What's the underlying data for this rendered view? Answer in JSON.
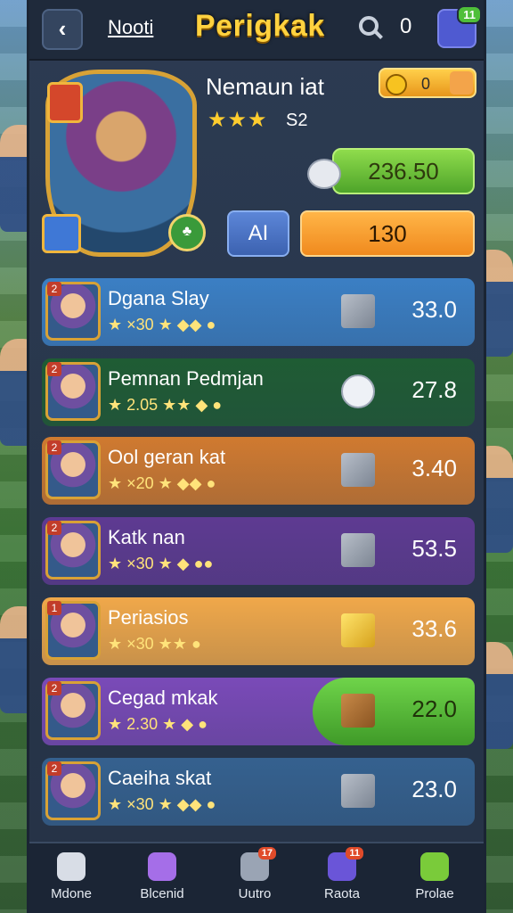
{
  "header": {
    "back_icon": "chevron-left-icon",
    "tab_label": "Nooti",
    "title": "Perigkak",
    "search_icon": "search-icon",
    "count": "0",
    "chat_badge": "11"
  },
  "hero": {
    "name": "Nemaun iat",
    "stars": "★★★",
    "level": "S2",
    "coins": "0",
    "score": "236.50",
    "ai_label": "AI",
    "power": "130"
  },
  "rows": [
    {
      "rank": "2",
      "name": "Dgana Slay",
      "stats": "★ ×30 ★ ◆◆ ●",
      "value": "33.0",
      "icon": "grey-cube-icon",
      "bg": "#3b7fc4"
    },
    {
      "rank": "2",
      "name": "Pemnan Pedmjan",
      "stats": "★ 2.05 ★★ ◆ ●",
      "value": "27.8",
      "icon": "chat-bubble-icon",
      "bg": "#1f5c34"
    },
    {
      "rank": "2",
      "name": "Ool geran kat",
      "stats": "★ ×20 ★ ◆◆ ●",
      "value": "3.40",
      "icon": "grey-cube-icon",
      "bg": "#d07a30"
    },
    {
      "rank": "2",
      "name": "Katk nan",
      "stats": "★ ×30 ★ ◆ ●●",
      "value": "53.5",
      "icon": "grey-cube-icon",
      "bg": "#5e3a92"
    },
    {
      "rank": "1",
      "name": "Periasios",
      "stats": "★ ×30 ★★ ●",
      "value": "33.6",
      "icon": "gold-cube-icon",
      "bg": "#f0a84a"
    },
    {
      "rank": "2",
      "name": "Cegad mkak",
      "stats": "★ 2.30 ★ ◆ ●",
      "value": "22.0",
      "icon": "crate-icon",
      "bg": "#7a4ab8"
    },
    {
      "rank": "2",
      "name": "Caeiha skat",
      "stats": "★ ×30 ★ ◆◆ ●",
      "value": "23.0",
      "icon": "grey-cube-icon",
      "bg": "#35618f"
    }
  ],
  "nav": [
    {
      "label": "Mdone",
      "icon": "home-icon"
    },
    {
      "label": "Blcenid",
      "icon": "search-icon"
    },
    {
      "label": "Uutro",
      "icon": "badge-icon",
      "badge": "17"
    },
    {
      "label": "Raota",
      "icon": "cards-icon",
      "badge": "11"
    },
    {
      "label": "Prolae",
      "icon": "star-icon"
    }
  ]
}
